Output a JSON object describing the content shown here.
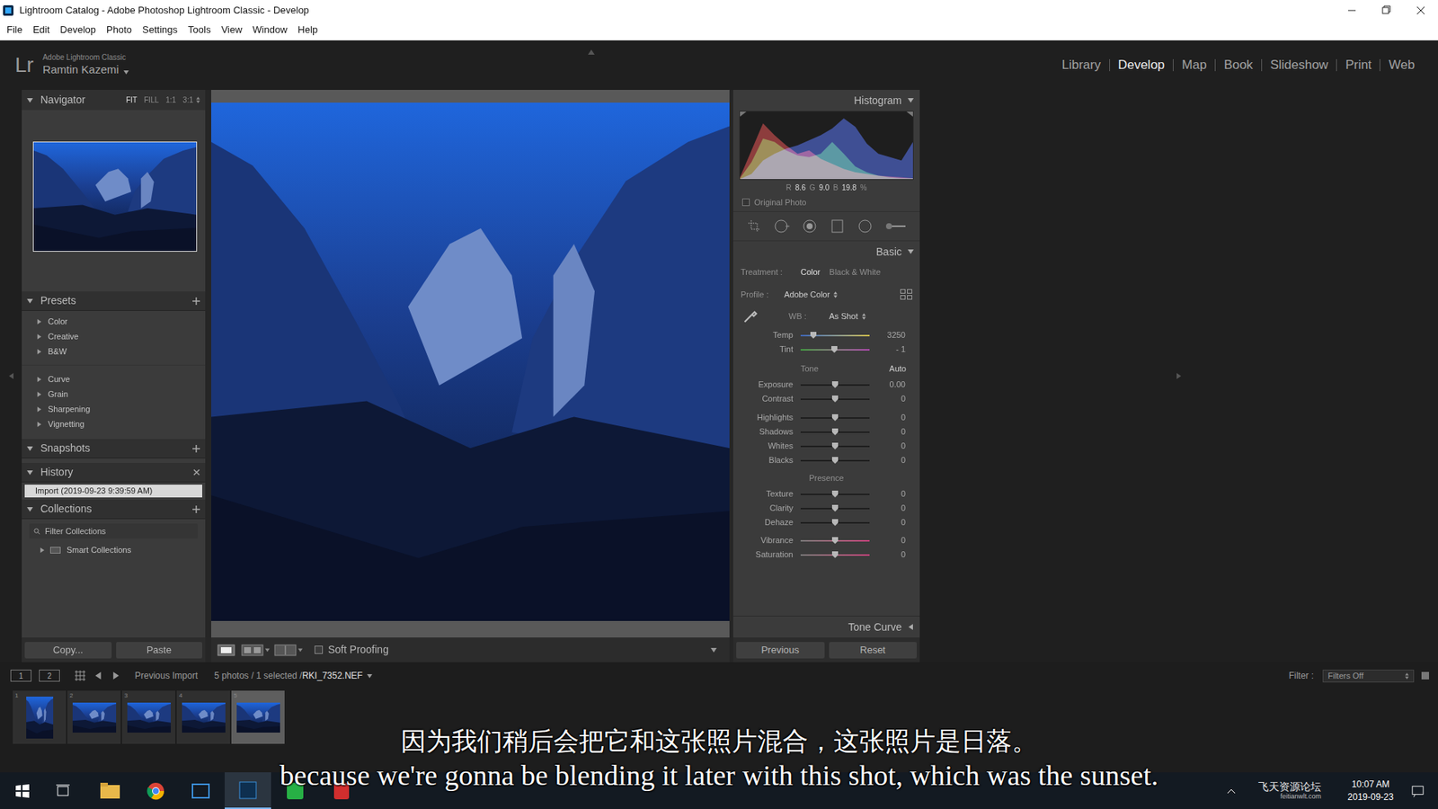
{
  "window": {
    "title": "Lightroom Catalog - Adobe Photoshop Lightroom Classic - Develop"
  },
  "menu": [
    "File",
    "Edit",
    "Develop",
    "Photo",
    "Settings",
    "Tools",
    "View",
    "Window",
    "Help"
  ],
  "identity": {
    "logo": "Lr",
    "product": "Adobe Lightroom Classic",
    "user": "Ramtin Kazemi"
  },
  "modules": [
    {
      "label": "Library",
      "selected": false
    },
    {
      "label": "Develop",
      "selected": true
    },
    {
      "label": "Map",
      "selected": false
    },
    {
      "label": "Book",
      "selected": false
    },
    {
      "label": "Slideshow",
      "selected": false
    },
    {
      "label": "Print",
      "selected": false
    },
    {
      "label": "Web",
      "selected": false
    }
  ],
  "navigator": {
    "title": "Navigator",
    "zoom": [
      {
        "label": "FIT",
        "selected": true
      },
      {
        "label": "FILL",
        "selected": false
      },
      {
        "label": "1:1",
        "selected": false
      },
      {
        "label": "3:1",
        "selected": false
      }
    ]
  },
  "presets": {
    "title": "Presets",
    "sections": [
      {
        "items": [
          {
            "label": "Color",
            "expanded": false
          },
          {
            "label": "Creative",
            "expanded": false
          },
          {
            "label": "B&W",
            "expanded": false
          }
        ]
      },
      {
        "items": [
          {
            "label": "Curve",
            "expanded": false
          },
          {
            "label": "Grain",
            "expanded": false
          },
          {
            "label": "Sharpening",
            "expanded": false
          },
          {
            "label": "Vignetting",
            "expanded": false
          }
        ]
      }
    ]
  },
  "snapshots": {
    "title": "Snapshots"
  },
  "history": {
    "title": "History",
    "items": [
      {
        "label": "Import (2019-09-23 9:39:59 AM)",
        "selected": true
      }
    ]
  },
  "collections": {
    "title": "Collections",
    "search": {
      "placeholder": "Filter Collections"
    },
    "items": [
      {
        "label": "Smart Collections",
        "expanded": false
      }
    ]
  },
  "left_buttons": [
    "Copy...",
    "Paste"
  ],
  "toolbar": {
    "soft_proofing": {
      "label": "Soft Proofing",
      "checked": false
    }
  },
  "histogram": {
    "title": "Histogram",
    "readings": [
      {
        "label": "R",
        "value": "8.6"
      },
      {
        "label": "G",
        "value": "9.0"
      },
      {
        "label": "B",
        "value": "19.8"
      }
    ],
    "unit": "%",
    "original_photo": {
      "label": "Original Photo",
      "checked": false
    },
    "series": [
      {
        "name": "red",
        "color": "#d23a3a",
        "values": [
          2,
          34,
          66,
          52,
          40,
          30,
          34,
          24,
          18,
          12,
          8,
          6,
          4,
          3,
          2,
          1
        ]
      },
      {
        "name": "green",
        "color": "#3fb43f",
        "values": [
          1,
          20,
          48,
          44,
          34,
          28,
          26,
          30,
          44,
          30,
          15,
          8,
          4,
          2,
          1,
          1
        ]
      },
      {
        "name": "blue",
        "color": "#3d5ce0",
        "values": [
          0,
          6,
          22,
          30,
          36,
          40,
          46,
          52,
          60,
          72,
          62,
          42,
          30,
          26,
          22,
          44
        ]
      }
    ]
  },
  "basic": {
    "title": "Basic",
    "treatment": {
      "label": "Treatment :",
      "options": [
        {
          "label": "Color",
          "selected": true
        },
        {
          "label": "Black & White",
          "selected": false
        }
      ]
    },
    "profile": {
      "label": "Profile :",
      "value": "Adobe Color"
    },
    "wb": {
      "label": "WB :",
      "value": "As Shot",
      "sliders": [
        {
          "label": "Temp",
          "value": "3250",
          "level": 0.18,
          "kind": "temp"
        },
        {
          "label": "Tint",
          "value": "- 1",
          "level": 0.49,
          "kind": "tint"
        }
      ]
    },
    "tone": {
      "label": "Tone",
      "auto": "Auto",
      "groups": [
        [
          {
            "label": "Exposure",
            "value": "0.00",
            "level": 0.5,
            "kind": "plain"
          },
          {
            "label": "Contrast",
            "value": "0",
            "level": 0.5,
            "kind": "plain"
          }
        ],
        [
          {
            "label": "Highlights",
            "value": "0",
            "level": 0.5,
            "kind": "plain"
          },
          {
            "label": "Shadows",
            "value": "0",
            "level": 0.5,
            "kind": "plain"
          },
          {
            "label": "Whites",
            "value": "0",
            "level": 0.5,
            "kind": "plain"
          },
          {
            "label": "Blacks",
            "value": "0",
            "level": 0.5,
            "kind": "plain"
          }
        ]
      ]
    },
    "presence": {
      "label": "Presence",
      "groups": [
        [
          {
            "label": "Texture",
            "value": "0",
            "level": 0.5,
            "kind": "plain"
          },
          {
            "label": "Clarity",
            "value": "0",
            "level": 0.5,
            "kind": "plain"
          },
          {
            "label": "Dehaze",
            "value": "0",
            "level": 0.5,
            "kind": "plain"
          }
        ],
        [
          {
            "label": "Vibrance",
            "value": "0",
            "level": 0.5,
            "kind": "vibrance"
          },
          {
            "label": "Saturation",
            "value": "0",
            "level": 0.5,
            "kind": "saturation"
          }
        ]
      ]
    }
  },
  "tone_curve": {
    "title": "Tone Curve"
  },
  "right_buttons": [
    "Previous",
    "Reset"
  ],
  "filmstrip": {
    "screens": [
      "1",
      "2"
    ],
    "source": "Previous Import",
    "info": "5 photos / 1 selected /",
    "file": "RKI_7352.NEF",
    "filter_label": "Filter :",
    "filter_value": "Filters Off",
    "thumbnails": [
      {
        "number": "1",
        "selected": false,
        "kind": "portrait"
      },
      {
        "number": "2",
        "selected": false,
        "kind": "landscape"
      },
      {
        "number": "3",
        "selected": false,
        "kind": "landscape"
      },
      {
        "number": "4",
        "selected": false,
        "kind": "landscape"
      },
      {
        "number": "5",
        "selected": true,
        "kind": "landscape"
      }
    ]
  },
  "subtitles": {
    "chinese": "因为我们稍后会把它和这张照片混合，这张照片是日落。",
    "english": "because we're gonna be blending it later with this shot, which was the sunset."
  },
  "taskbar": {
    "time": "10:07 AM",
    "date": "2019-09-23",
    "watermark": [
      "飞天资源论坛",
      "feitianwlt.com"
    ]
  }
}
